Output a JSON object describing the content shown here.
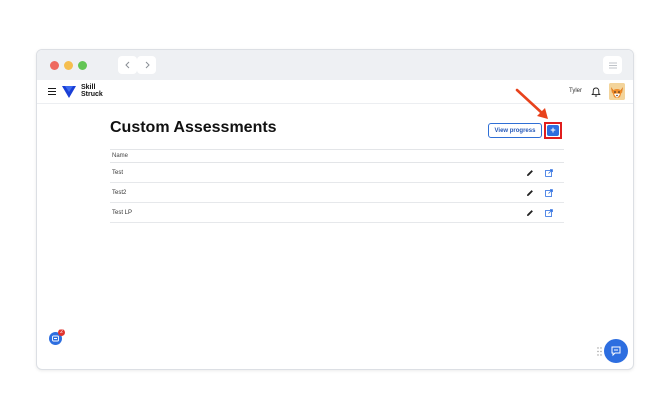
{
  "app": {
    "logo_line1": "Skill",
    "logo_line2": "Struck",
    "user_name": "Tyler"
  },
  "page": {
    "title": "Custom Assessments",
    "view_progress_label": "View progress",
    "add_label": "+"
  },
  "table": {
    "columns": [
      "Name"
    ],
    "rows": [
      {
        "name": "Test"
      },
      {
        "name": "Test2"
      },
      {
        "name": "Test LP"
      }
    ]
  },
  "help": {
    "badge_count": "2"
  },
  "colors": {
    "accent": "#2d6ee0",
    "highlight": "#e01e1e",
    "brand": "#1a3fd6"
  },
  "icons": [
    "hamburger-icon",
    "bell-icon",
    "pencil-icon",
    "external-link-icon",
    "chat-icon",
    "drag-handle-icon",
    "help-icon"
  ]
}
